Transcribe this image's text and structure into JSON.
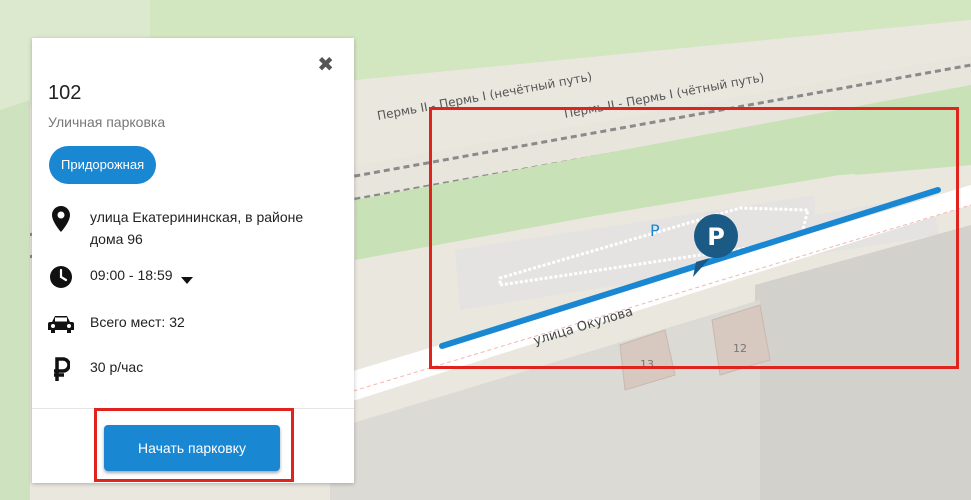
{
  "map": {
    "rail_label_1": "Пермь II - Пермь I (нечётный путь)",
    "rail_label_2": "Пермь II - Пермь I (чётный путь)",
    "street_label": "улица Окулова",
    "house_12": "12",
    "house_13": "13",
    "parking_letter": "P",
    "pin_letter": "P"
  },
  "panel": {
    "id": "102",
    "type": "Уличная парковка",
    "badge": "Придорожная",
    "address": "улица Екатерининская, в районе дома 96",
    "hours": "09:00 - 18:59",
    "spaces": "Всего мест: 32",
    "price": "30 р/час",
    "start_button": "Начать парковку",
    "close_glyph": "✖"
  },
  "colors": {
    "accent": "#1a87d3",
    "highlight": "#e1231e"
  }
}
